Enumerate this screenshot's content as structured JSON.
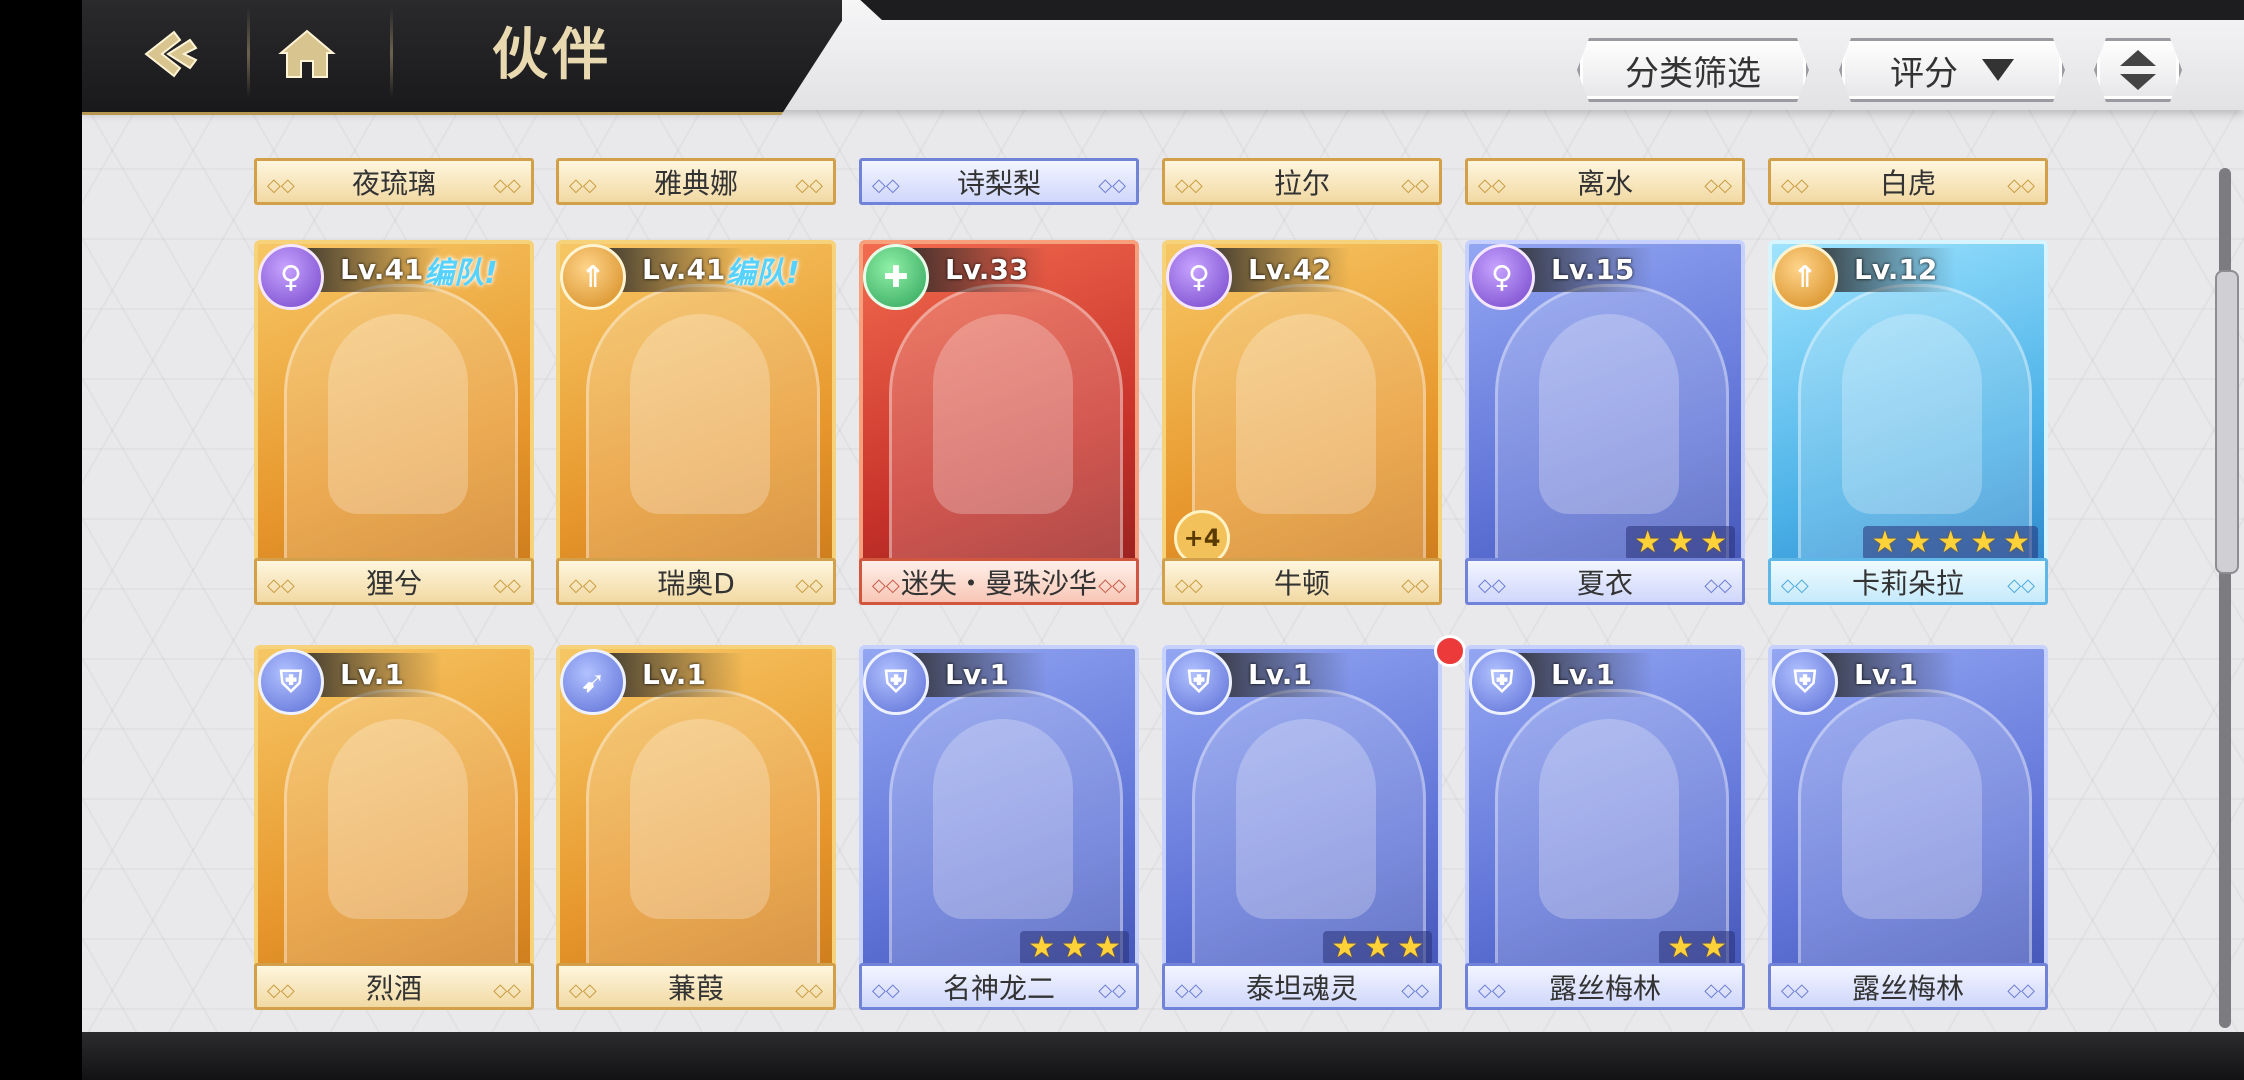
{
  "header": {
    "title": "伙伴",
    "back_icon": "back-arrow-icon",
    "home_icon": "home-icon"
  },
  "toolbar": {
    "filter_label": "分类筛选",
    "sort_label": "评分",
    "order_icon": "sort-order-icon"
  },
  "colors": {
    "gold": "#e7972c",
    "red": "#c8322a",
    "blue": "#5f73d7",
    "cyan": "#4bb1e7",
    "team_tag": "#55d2ff"
  },
  "top_row": [
    {
      "name": "夜琉璃",
      "style": "gold"
    },
    {
      "name": "雅典娜",
      "style": "gold"
    },
    {
      "name": "诗梨梨",
      "style": "blue"
    },
    {
      "name": "拉尔",
      "style": "gold"
    },
    {
      "name": "离水",
      "style": "gold"
    },
    {
      "name": "白虎",
      "style": "gold"
    }
  ],
  "row1": [
    {
      "name": "狸兮",
      "level": "Lv.41",
      "team": "编队!",
      "style": "gold",
      "class_icon": "mage-icon"
    },
    {
      "name": "瑞奥D",
      "level": "Lv.41",
      "team": "编队!",
      "style": "gold",
      "class_icon": "warrior-icon"
    },
    {
      "name": "迷失・曼珠沙华",
      "level": "Lv.33",
      "style": "red",
      "class_icon": "healer-icon"
    },
    {
      "name": "牛顿",
      "level": "Lv.42",
      "style": "gold",
      "class_icon": "mage-icon",
      "plus": "+4"
    },
    {
      "name": "夏衣",
      "level": "Lv.15",
      "style": "blue",
      "class_icon": "mage-icon",
      "stars": 3
    },
    {
      "name": "卡莉朵拉",
      "level": "Lv.12",
      "style": "cyan",
      "class_icon": "warrior-icon",
      "stars": 5
    }
  ],
  "row2": [
    {
      "name": "烈酒",
      "level": "Lv.1",
      "style": "gold",
      "class_icon": "shield-icon"
    },
    {
      "name": "蒹葭",
      "level": "Lv.1",
      "style": "gold",
      "class_icon": "archer-icon"
    },
    {
      "name": "名神龙二",
      "level": "Lv.1",
      "style": "blue",
      "class_icon": "shield-icon",
      "stars": 3
    },
    {
      "name": "泰坦魂灵",
      "level": "Lv.1",
      "style": "blue",
      "class_icon": "shield-icon",
      "stars": 3,
      "new_dot": true
    },
    {
      "name": "露丝梅林",
      "level": "Lv.1",
      "style": "blue",
      "class_icon": "shield-icon",
      "stars": 2
    },
    {
      "name": "露丝梅林",
      "level": "Lv.1",
      "style": "blue",
      "class_icon": "shield-icon"
    }
  ]
}
